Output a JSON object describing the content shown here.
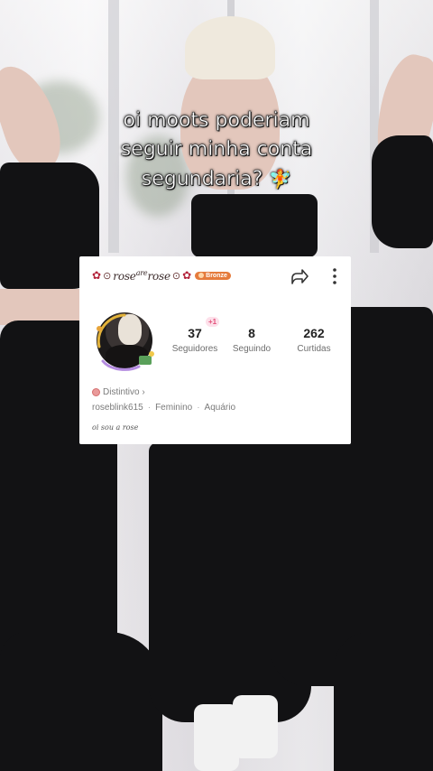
{
  "caption": {
    "line1": "oi moots poderiam",
    "line2": "seguir minha conta",
    "line3": "segundaria?",
    "emoji": "🧚"
  },
  "profile": {
    "display_name_part1": "rose",
    "display_name_sup": "are",
    "display_name_part2": "rose",
    "level_badge": "Bronze",
    "new_followers_badge": "+1",
    "stats": [
      {
        "value": "37",
        "label": "Seguidores"
      },
      {
        "value": "8",
        "label": "Seguindo"
      },
      {
        "value": "262",
        "label": "Curtidas"
      }
    ],
    "distintivo_label": "Distintivo ›",
    "username": "roseblink615",
    "gender": "Feminino",
    "sign": "Aquário",
    "bio": "oi sou a rose"
  },
  "colors": {
    "badge": "#e57b3c",
    "rose": "#b3243b",
    "plus_badge_text": "#e2507a"
  },
  "icons": {
    "share": "share-arrow-icon",
    "more": "more-vertical-icon"
  }
}
